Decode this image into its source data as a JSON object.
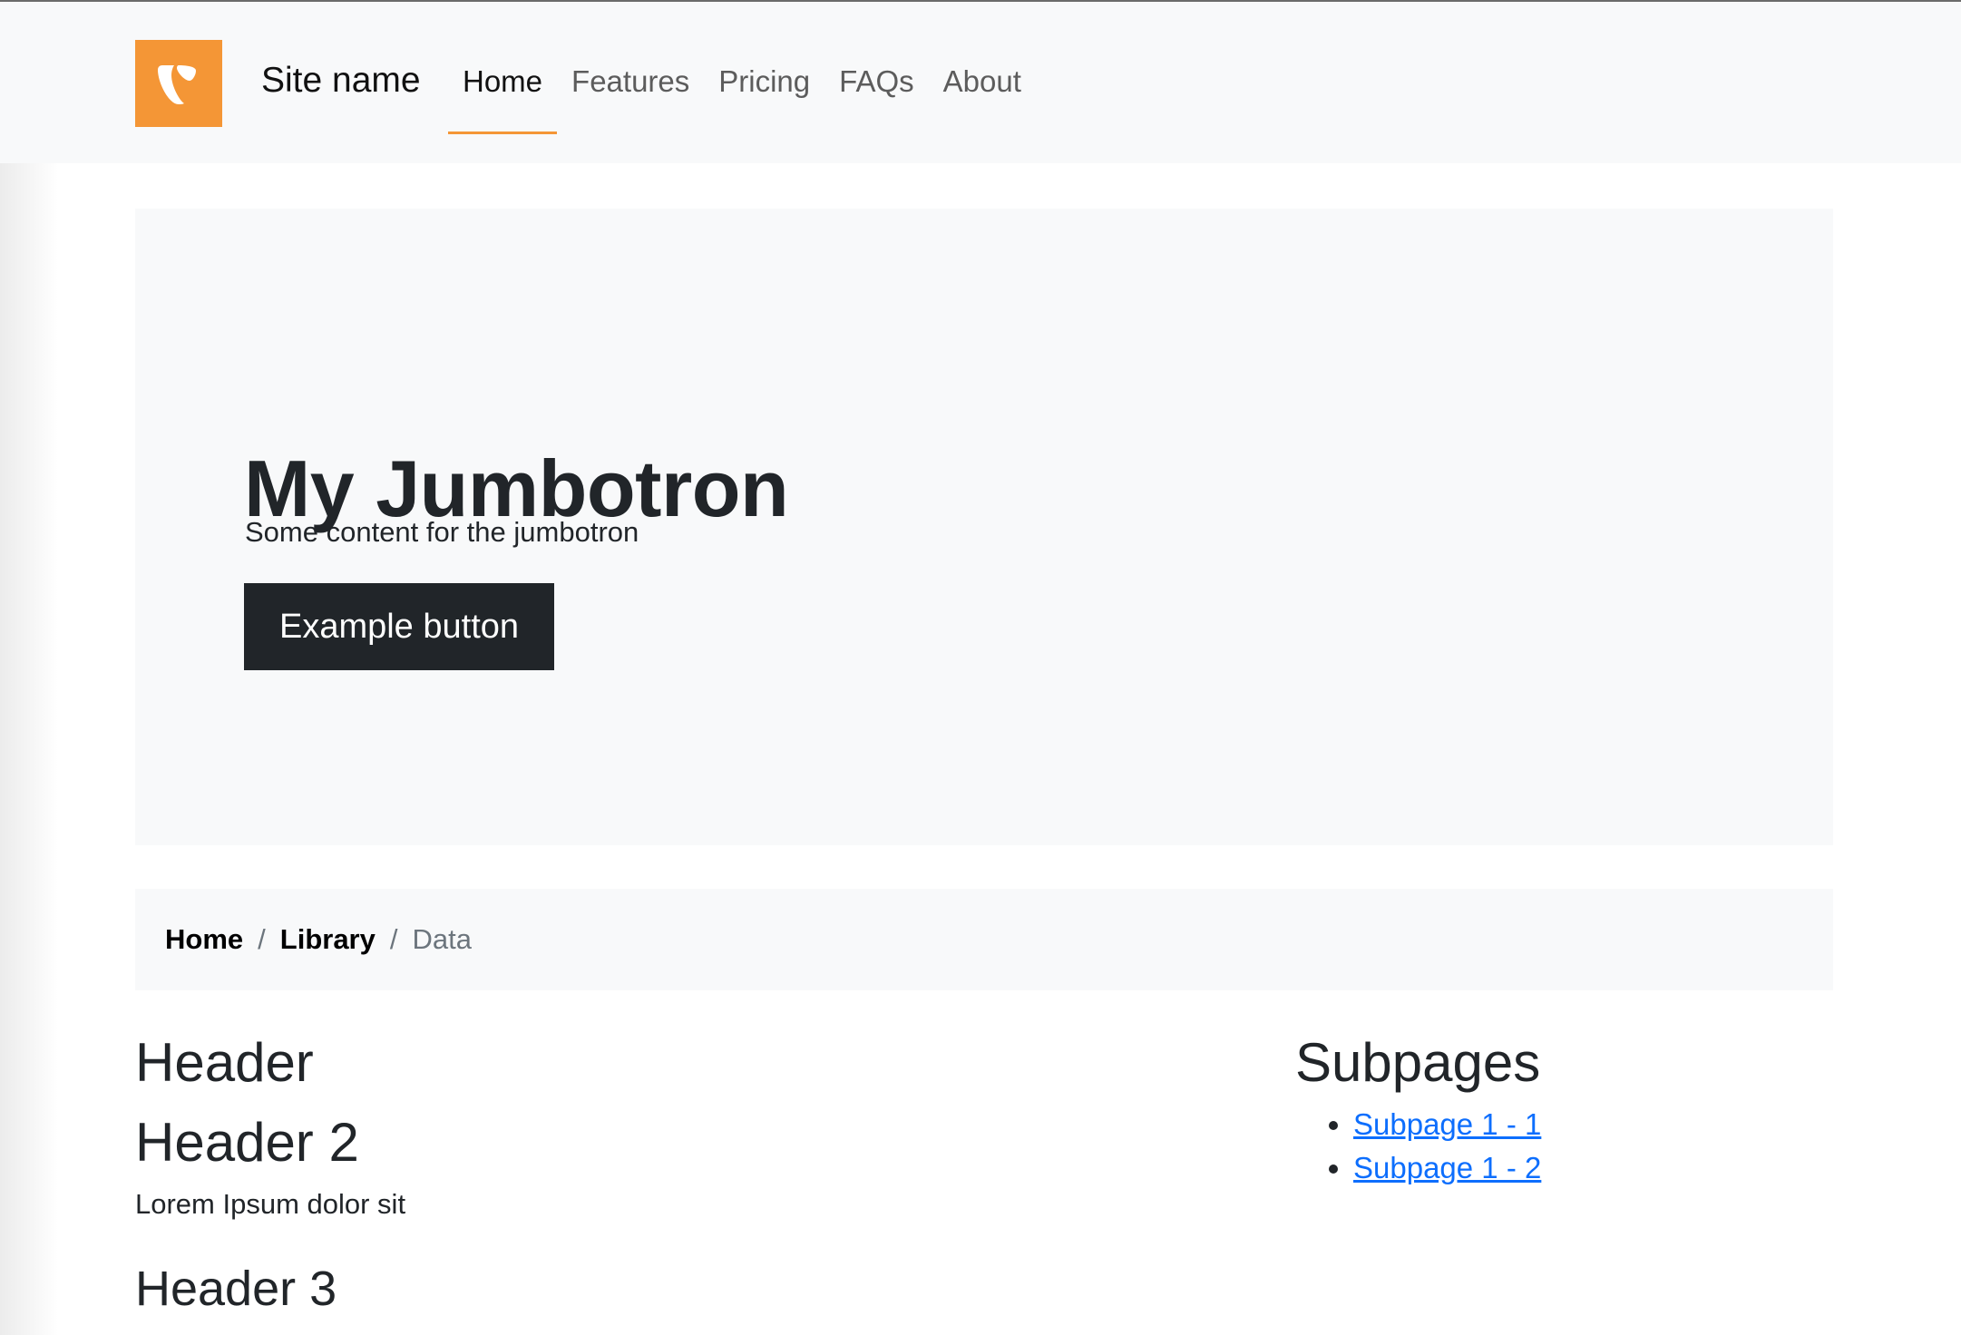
{
  "header": {
    "site_name": "Site name",
    "logo_color": "#f49636",
    "logo_icon": "typo3-icon",
    "nav": [
      {
        "label": "Home",
        "active": true
      },
      {
        "label": "Features",
        "active": false
      },
      {
        "label": "Pricing",
        "active": false
      },
      {
        "label": "FAQs",
        "active": false
      },
      {
        "label": "About",
        "active": false
      }
    ]
  },
  "jumbotron": {
    "title": "My Jumbotron",
    "text": "Some content for the jumbotron",
    "button_label": "Example button"
  },
  "breadcrumb": {
    "items": [
      "Home",
      "Library"
    ],
    "separator": "/",
    "current": "Data"
  },
  "content": {
    "header1": "Header",
    "header2": "Header 2",
    "paragraph": "Lorem Ipsum dolor sit",
    "header3": "Header 3"
  },
  "subpages": {
    "title": "Subpages",
    "links": [
      "Subpage 1 - 1",
      "Subpage 1 - 2"
    ]
  },
  "colors": {
    "accent": "#f49636",
    "link": "#0d6efd",
    "dark": "#212529",
    "light_bg": "#f8f9fa"
  }
}
